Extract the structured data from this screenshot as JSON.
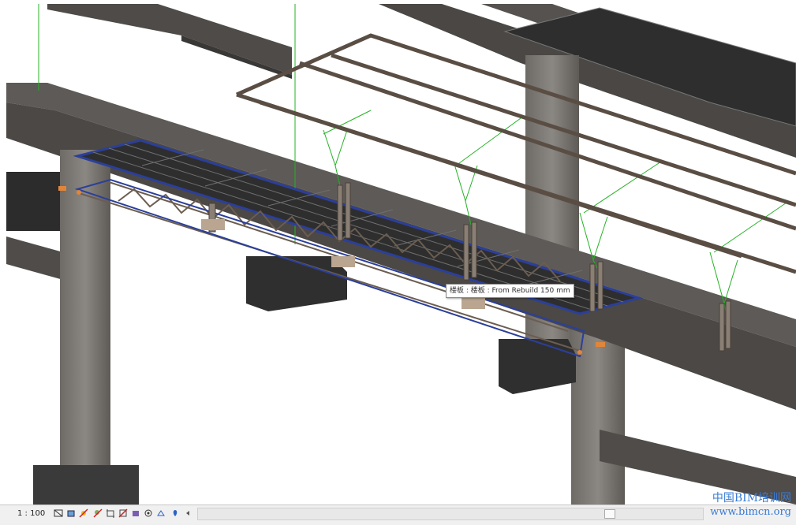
{
  "tooltip": {
    "text": "楼板 : 楼板 : From Rebuild 150 mm"
  },
  "status_bar": {
    "scale": "1 : 100",
    "view_controls": [
      "detail-level-icon",
      "visual-style-icon",
      "sun-path-icon",
      "shadows-icon",
      "crop-view-icon",
      "show-crop-icon",
      "temporary-hide-icon",
      "reveal-hidden-icon",
      "analytical-model-icon",
      "highlight-icon",
      "scroll-left-icon"
    ]
  },
  "watermark": {
    "chinese": "中国BIM培训网",
    "url": "www.bimcn.org"
  },
  "colors": {
    "selection": "#2b3f9a",
    "concrete": "#5f5c58",
    "slab": "#2e2e2e",
    "steel": "#5a4e44",
    "green": "#25b225",
    "watermark": "#3a7bd5"
  }
}
